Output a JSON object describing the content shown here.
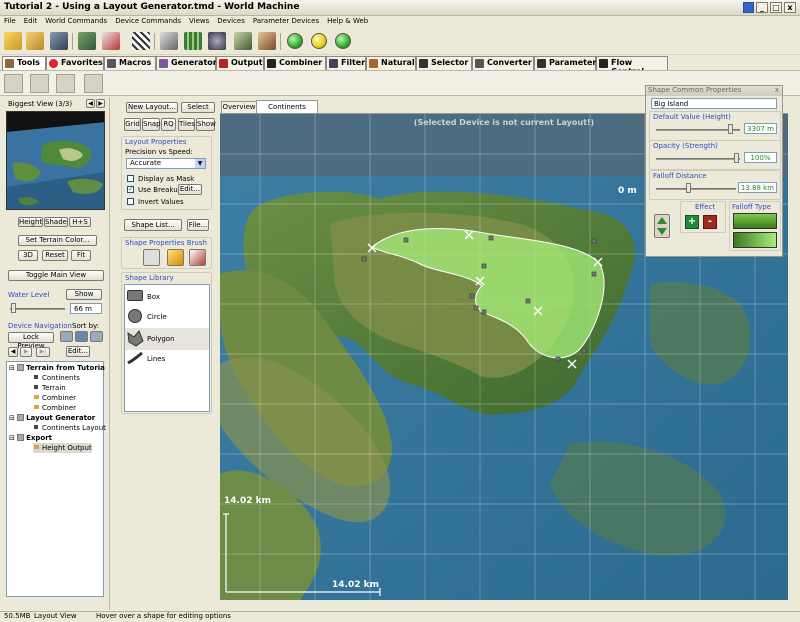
{
  "window": {
    "title": "Tutorial 2 - Using a Layout Generator.tmd - World Machine",
    "min": "_",
    "max": "□",
    "close": "x"
  },
  "menu": [
    "File",
    "Edit",
    "World Commands",
    "Device Commands",
    "Views",
    "Devices",
    "Parameter Devices",
    "Help & Web"
  ],
  "tabs": [
    "Tools",
    "Favorites",
    "Macros",
    "Generator",
    "Output",
    "Combiner",
    "Filter",
    "Natural",
    "Selector",
    "Converter",
    "Parameter",
    "Flow Control"
  ],
  "colors": {
    "green_ball": "#2db22d",
    "yellow_ball": "#e6d21a",
    "accent_blue": "#2f4bc6",
    "value_green": "#218c21"
  },
  "preview": {
    "title": "Biggest View (3/3)",
    "buttons": [
      "Height",
      "Shade",
      "H+S"
    ],
    "set_terrain_color": "Set Terrain Color...",
    "btn_3d": "3D",
    "reset": "Reset",
    "fit": "Fit",
    "toggle_main_view": "Toggle Main View"
  },
  "water": {
    "label": "Water Level",
    "show": "Show",
    "value": "66 m"
  },
  "device_nav": {
    "label": "Device Navigation",
    "sort_by": "Sort by:",
    "lock_preview": "Lock Preview",
    "edit": "Edit...",
    "tree": [
      {
        "label": "Terrain from Tutoria",
        "level": 0
      },
      {
        "label": "Continents",
        "level": 1
      },
      {
        "label": "Terrain",
        "level": 1
      },
      {
        "label": "Combiner",
        "level": 1
      },
      {
        "label": "Combiner",
        "level": 1
      },
      {
        "label": "Layout Generator",
        "level": 0
      },
      {
        "label": "Continents Layout",
        "level": 1
      },
      {
        "label": "Export",
        "level": 0
      },
      {
        "label": "Height Output",
        "level": 1
      }
    ]
  },
  "layout_panel": {
    "new_layout": "New Layout...",
    "select": "Select",
    "toggles": [
      "Grid",
      "Snap",
      "RQ",
      "Tiles",
      "Show"
    ],
    "props_title": "Layout Properties",
    "precision_label": "Precision vs Speed:",
    "precision_value": "Accurate",
    "display_mask": "Display as Mask",
    "use_breakup": "Use Breakup",
    "edit": "Edit...",
    "invert_values": "Invert Values",
    "shape_list": "Shape List...",
    "file": "File...",
    "brush_title": "Shape Properties Brush",
    "library_title": "Shape Library",
    "library": [
      "Box",
      "Circle",
      "Polygon",
      "Lines"
    ]
  },
  "view_tabs": [
    "Overview",
    "Continents Layout"
  ],
  "map": {
    "banner": "(Selected Device is not current Layout!)",
    "origin_label": "0 m",
    "vertical_scale": "14.02 km",
    "horizontal_scale": "14.02 km"
  },
  "shape_props": {
    "title": "Shape Common Properties",
    "close": "x",
    "name": "Big Island",
    "default_label": "Default Value (Height)",
    "default_value": "3307 m",
    "default_level": 0.92,
    "opacity_label": "Opacity (Strength)",
    "opacity_value": "100%",
    "opacity_level": 1.0,
    "falloff_label": "Falloff Distance",
    "falloff_value": "13.88 km",
    "falloff_level": 0.42,
    "effect_label": "Effect",
    "falloff_type_label": "Falloff Type"
  },
  "status": {
    "memory": "50.5MB",
    "view": "Layout View",
    "hint": "Hover over a shape for editing options"
  }
}
